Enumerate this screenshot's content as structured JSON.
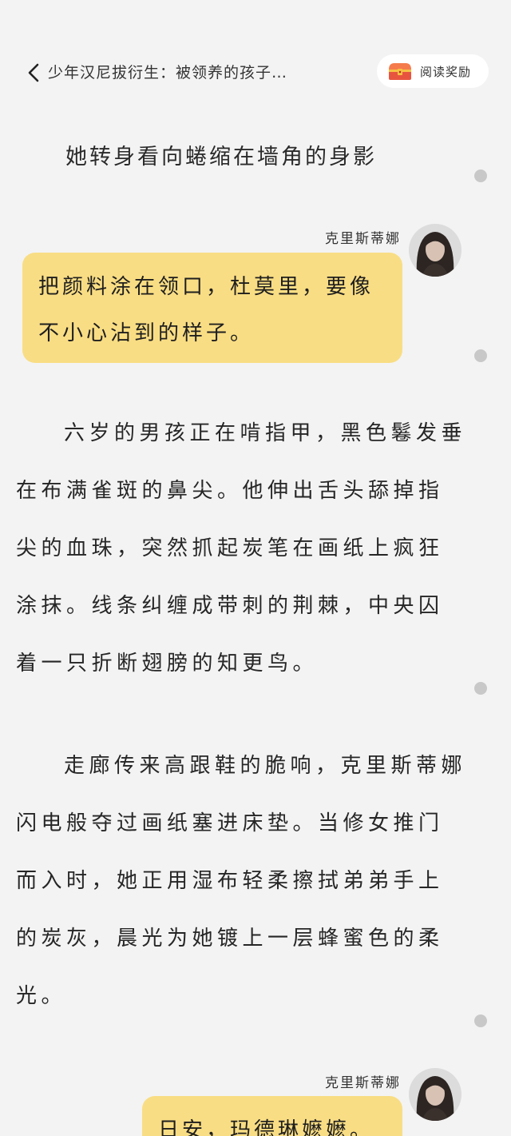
{
  "header": {
    "book_title": "少年汉尼拔衍生：被领养的孩子…",
    "reward_label": "阅读奖励"
  },
  "content": {
    "chapter_line": "她转身看向蜷缩在墙角的身影",
    "dialogue_1": {
      "speaker": "克里斯蒂娜",
      "text": "把颜料涂在领口，杜莫里，要像不小心沾到的样子。"
    },
    "paragraph_1": "六岁的男孩正在啃指甲，黑色鬈发垂在布满雀斑的鼻尖。他伸出舌头舔掉指尖的血珠，突然抓起炭笔在画纸上疯狂涂抹。线条纠缠成带刺的荆棘，中央囚着一只折断翅膀的知更鸟。",
    "paragraph_2": "走廊传来高跟鞋的脆响，克里斯蒂娜闪电般夺过画纸塞进床垫。当修女推门而入时，她正用湿布轻柔擦拭弟弟手上的炭灰，晨光为她镀上一层蜂蜜色的柔光。",
    "dialogue_2": {
      "speaker": "克里斯蒂娜",
      "text": "日安，玛德琳嬷嬷。"
    }
  },
  "colors": {
    "background": "#f3f3f3",
    "bubble": "#f9dd84",
    "dot": "#c8c8c8"
  },
  "icons": {
    "back": "chevron-left-icon",
    "reward": "treasure-chest-icon",
    "avatar": "avatar"
  }
}
